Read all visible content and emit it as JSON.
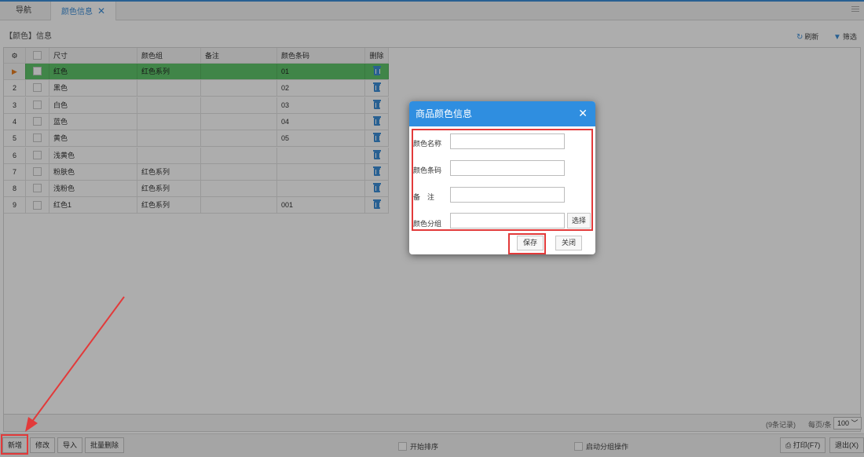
{
  "tabs": {
    "nav_label": "导航",
    "active_label": "颜色信息",
    "close_glyph": "✕"
  },
  "header": {
    "title": "【颜色】信息",
    "refresh_label": "刷新",
    "filter_label": "筛选"
  },
  "grid": {
    "columns": {
      "size": "尺寸",
      "group": "颜色组",
      "note": "备注",
      "code": "颜色条码",
      "delete": "删除"
    },
    "rows": [
      {
        "rn": "▶",
        "size": "红色",
        "group": "红色系列",
        "note": "",
        "code": "01"
      },
      {
        "rn": "2",
        "size": "黑色",
        "group": "",
        "note": "",
        "code": "02"
      },
      {
        "rn": "3",
        "size": "白色",
        "group": "",
        "note": "",
        "code": "03"
      },
      {
        "rn": "4",
        "size": "蓝色",
        "group": "",
        "note": "",
        "code": "04"
      },
      {
        "rn": "5",
        "size": "黄色",
        "group": "",
        "note": "",
        "code": "05"
      },
      {
        "rn": "6",
        "size": "浅黄色",
        "group": "",
        "note": "",
        "code": ""
      },
      {
        "rn": "7",
        "size": "粉肤色",
        "group": "红色系列",
        "note": "",
        "code": ""
      },
      {
        "rn": "8",
        "size": "浅粉色",
        "group": "红色系列",
        "note": "",
        "code": ""
      },
      {
        "rn": "9",
        "size": "红色1",
        "group": "红色系列",
        "note": "",
        "code": "001"
      }
    ]
  },
  "status": {
    "record_count": "(9条记录)",
    "per_page_label": "每页/条",
    "per_page_value": "100"
  },
  "bottom_toolbar": {
    "add": "新增",
    "edit": "修改",
    "import": "导入",
    "batch_delete": "批量删除",
    "sort_toggle": "开始排序",
    "group_toggle": "启动分组操作",
    "print": "打印(F7)",
    "exit": "退出(X)"
  },
  "dialog": {
    "title": "商品颜色信息",
    "close_glyph": "✕",
    "fields": {
      "name_label": "颜色名称",
      "code_label": "颜色条码",
      "note_label": "备　注",
      "group_label": "颜色分组"
    },
    "select_button": "选择",
    "save_button": "保存",
    "cancel_button": "关闭"
  },
  "colors": {
    "accent": "#2f8ee0",
    "selected_row": "#5fc46a",
    "annotation": "#e23a3a"
  }
}
